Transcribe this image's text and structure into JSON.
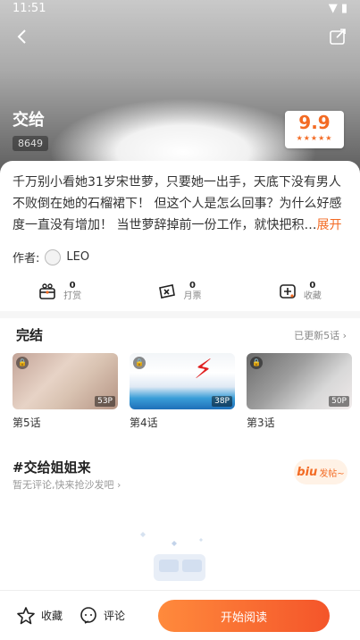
{
  "status_bar": {
    "time": "11:51"
  },
  "header": {
    "title": "交给",
    "count": "8649"
  },
  "score": {
    "value": "9.9"
  },
  "description": {
    "text": "千万别小看她31岁宋世萝，只要她一出手，天底下没有男人不败倒在她的石榴裙下！ 但这个人是怎么回事？为什么好感度一直没有增加！ 当世萝辞掉前一份工作，就快把积…",
    "more": "展开"
  },
  "author": {
    "label": "作者:",
    "name": "LEO"
  },
  "stats": [
    {
      "num": "0",
      "label": "打赏",
      "icon": "gift-box-icon"
    },
    {
      "num": "0",
      "label": "月票",
      "icon": "ticket-icon"
    },
    {
      "num": "0",
      "label": "收藏",
      "icon": "collect-icon"
    }
  ],
  "section": {
    "title": "完结",
    "more": "已更新5话"
  },
  "episodes": [
    {
      "label": "第5话",
      "pages": "53P"
    },
    {
      "label": "第4话",
      "pages": "38P"
    },
    {
      "label": "第3话",
      "pages": "50P"
    }
  ],
  "comments": {
    "title": "#交给姐姐来",
    "subtitle": "暂无评论,快来抢沙发吧",
    "post_logo": "biu",
    "post_label": "发帖~"
  },
  "bottom": {
    "favorite": "收藏",
    "comment": "评论",
    "read": "开始阅读"
  },
  "colors": {
    "accent": "#f36b24"
  }
}
